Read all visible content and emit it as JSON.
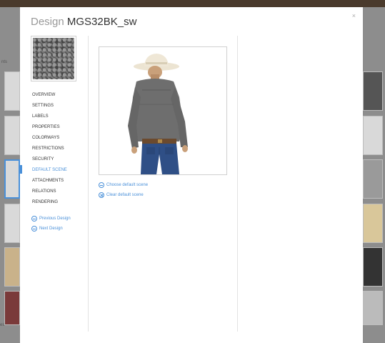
{
  "modal": {
    "title_prefix": "Design",
    "title_name": "MGS32BK_sw",
    "close_label": "×"
  },
  "nav": {
    "items": [
      {
        "label": "OVERVIEW"
      },
      {
        "label": "SETTINGS"
      },
      {
        "label": "LABELS"
      },
      {
        "label": "PROPERTIES"
      },
      {
        "label": "COLORWAYS"
      },
      {
        "label": "RESTRICTIONS"
      },
      {
        "label": "SECURITY"
      },
      {
        "label": "DEFAULT SCENE"
      },
      {
        "label": "ATTACHMENTS"
      },
      {
        "label": "RELATIONS"
      },
      {
        "label": "RENDERING"
      }
    ],
    "active": "DEFAULT SCENE",
    "previous_label": "Previous Design",
    "next_label": "Next Design"
  },
  "scene": {
    "choose_label": "Choose default scene",
    "clear_label": "Clear default scene"
  },
  "background": {
    "left_label": "nts",
    "left_bottom_label": "es"
  },
  "colors": {
    "accent": "#4a90d9",
    "overlay": "#5c5c5c",
    "shirt": "#6e6e6e",
    "jeans": "#2f4f86",
    "hat": "#efe7d6"
  }
}
